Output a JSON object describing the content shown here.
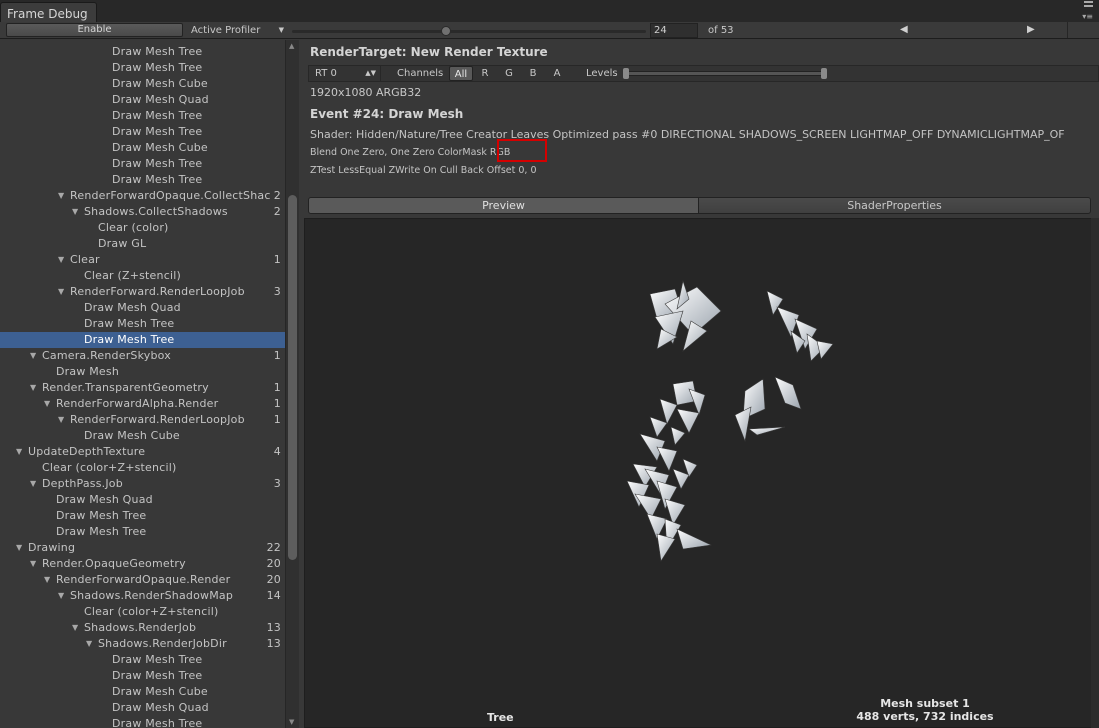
{
  "window": {
    "tab_title": "Frame Debug"
  },
  "toolbar": {
    "enable_label": "Enable",
    "profiler_label": "Active Profiler",
    "event_index": "24",
    "event_total": "of 53",
    "prev_icon": "◀",
    "next_icon": "▶"
  },
  "tree": {
    "rows": [
      {
        "label": "Draw Mesh Tree",
        "indent": 7,
        "count": "",
        "expanded": null,
        "selected": false
      },
      {
        "label": "Draw Mesh Tree",
        "indent": 7,
        "count": "",
        "expanded": null,
        "selected": false
      },
      {
        "label": "Draw Mesh Cube",
        "indent": 7,
        "count": "",
        "expanded": null,
        "selected": false
      },
      {
        "label": "Draw Mesh Quad",
        "indent": 7,
        "count": "",
        "expanded": null,
        "selected": false
      },
      {
        "label": "Draw Mesh Tree",
        "indent": 7,
        "count": "",
        "expanded": null,
        "selected": false
      },
      {
        "label": "Draw Mesh Tree",
        "indent": 7,
        "count": "",
        "expanded": null,
        "selected": false
      },
      {
        "label": "Draw Mesh Cube",
        "indent": 7,
        "count": "",
        "expanded": null,
        "selected": false
      },
      {
        "label": "Draw Mesh Tree",
        "indent": 7,
        "count": "",
        "expanded": null,
        "selected": false
      },
      {
        "label": "Draw Mesh Tree",
        "indent": 7,
        "count": "",
        "expanded": null,
        "selected": false
      },
      {
        "label": "RenderForwardOpaque.CollectShac",
        "indent": 4,
        "count": "2",
        "expanded": true,
        "selected": false
      },
      {
        "label": "Shadows.CollectShadows",
        "indent": 5,
        "count": "2",
        "expanded": true,
        "selected": false
      },
      {
        "label": "Clear (color)",
        "indent": 6,
        "count": "",
        "expanded": null,
        "selected": false
      },
      {
        "label": "Draw GL",
        "indent": 6,
        "count": "",
        "expanded": null,
        "selected": false
      },
      {
        "label": "Clear",
        "indent": 4,
        "count": "1",
        "expanded": true,
        "selected": false
      },
      {
        "label": "Clear (Z+stencil)",
        "indent": 5,
        "count": "",
        "expanded": null,
        "selected": false
      },
      {
        "label": "RenderForward.RenderLoopJob",
        "indent": 4,
        "count": "3",
        "expanded": true,
        "selected": false
      },
      {
        "label": "Draw Mesh Quad",
        "indent": 5,
        "count": "",
        "expanded": null,
        "selected": false
      },
      {
        "label": "Draw Mesh Tree",
        "indent": 5,
        "count": "",
        "expanded": null,
        "selected": false
      },
      {
        "label": "Draw Mesh Tree",
        "indent": 5,
        "count": "",
        "expanded": null,
        "selected": true
      },
      {
        "label": "Camera.RenderSkybox",
        "indent": 2,
        "count": "1",
        "expanded": true,
        "selected": false
      },
      {
        "label": "Draw Mesh",
        "indent": 3,
        "count": "",
        "expanded": null,
        "selected": false
      },
      {
        "label": "Render.TransparentGeometry",
        "indent": 2,
        "count": "1",
        "expanded": true,
        "selected": false
      },
      {
        "label": "RenderForwardAlpha.Render",
        "indent": 3,
        "count": "1",
        "expanded": true,
        "selected": false
      },
      {
        "label": "RenderForward.RenderLoopJob",
        "indent": 4,
        "count": "1",
        "expanded": true,
        "selected": false
      },
      {
        "label": "Draw Mesh Cube",
        "indent": 5,
        "count": "",
        "expanded": null,
        "selected": false
      },
      {
        "label": "UpdateDepthTexture",
        "indent": 1,
        "count": "4",
        "expanded": true,
        "selected": false
      },
      {
        "label": "Clear (color+Z+stencil)",
        "indent": 2,
        "count": "",
        "expanded": null,
        "selected": false
      },
      {
        "label": "DepthPass.Job",
        "indent": 2,
        "count": "3",
        "expanded": true,
        "selected": false
      },
      {
        "label": "Draw Mesh Quad",
        "indent": 3,
        "count": "",
        "expanded": null,
        "selected": false
      },
      {
        "label": "Draw Mesh Tree",
        "indent": 3,
        "count": "",
        "expanded": null,
        "selected": false
      },
      {
        "label": "Draw Mesh Tree",
        "indent": 3,
        "count": "",
        "expanded": null,
        "selected": false
      },
      {
        "label": "Drawing",
        "indent": 1,
        "count": "22",
        "expanded": true,
        "selected": false
      },
      {
        "label": "Render.OpaqueGeometry",
        "indent": 2,
        "count": "20",
        "expanded": true,
        "selected": false
      },
      {
        "label": "RenderForwardOpaque.Render",
        "indent": 3,
        "count": "20",
        "expanded": true,
        "selected": false
      },
      {
        "label": "Shadows.RenderShadowMap",
        "indent": 4,
        "count": "14",
        "expanded": true,
        "selected": false
      },
      {
        "label": "Clear (color+Z+stencil)",
        "indent": 5,
        "count": "",
        "expanded": null,
        "selected": false
      },
      {
        "label": "Shadows.RenderJob",
        "indent": 5,
        "count": "13",
        "expanded": true,
        "selected": false
      },
      {
        "label": "Shadows.RenderJobDir",
        "indent": 6,
        "count": "13",
        "expanded": true,
        "selected": false
      },
      {
        "label": "Draw Mesh Tree",
        "indent": 7,
        "count": "",
        "expanded": null,
        "selected": false
      },
      {
        "label": "Draw Mesh Tree",
        "indent": 7,
        "count": "",
        "expanded": null,
        "selected": false
      },
      {
        "label": "Draw Mesh Cube",
        "indent": 7,
        "count": "",
        "expanded": null,
        "selected": false
      },
      {
        "label": "Draw Mesh Quad",
        "indent": 7,
        "count": "",
        "expanded": null,
        "selected": false
      },
      {
        "label": "Draw Mesh Tree",
        "indent": 7,
        "count": "",
        "expanded": null,
        "selected": false
      }
    ]
  },
  "details": {
    "render_target": "RenderTarget: New Render Texture",
    "rt_select": "RT 0",
    "channels_label": "Channels",
    "channels": [
      "All",
      "R",
      "G",
      "B",
      "A"
    ],
    "active_channel": "All",
    "levels_label": "Levels",
    "rt_size": "1920x1080 ARGB32",
    "event_title": "Event #24: Draw Mesh",
    "shader_line": "Shader: Hidden/Nature/Tree Creator Leaves Optimized pass #0  DIRECTIONAL SHADOWS_SCREEN LIGHTMAP_OFF DYNAMICLIGHTMAP_OF",
    "blend_line": "Blend One Zero, One Zero ColorMask RGB",
    "ztest_line": "ZTest LessEqual ZWrite On Cull Back Offset 0, 0",
    "tabs": {
      "preview": "Preview",
      "shader_properties": "ShaderProperties"
    },
    "preview_name": "Tree",
    "mesh_subset_line1": "Mesh subset 1",
    "mesh_subset_line2": "488 verts, 732 indices"
  },
  "colors": {
    "selection": "#3d6092",
    "highlight_box": "#d40000",
    "panel_bg": "#383838",
    "preview_bg": "#262626"
  }
}
